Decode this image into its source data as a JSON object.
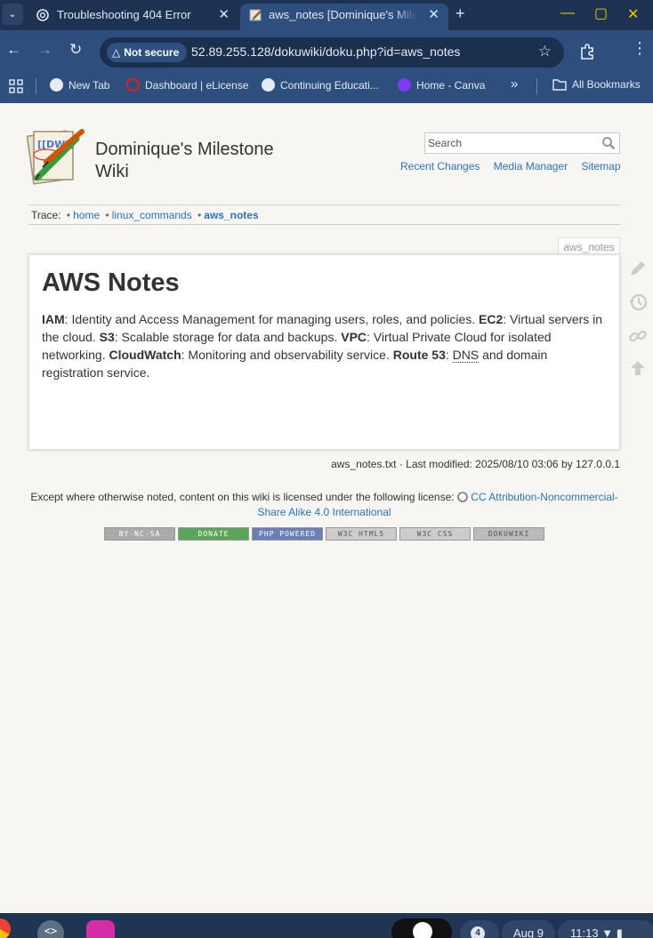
{
  "browser": {
    "tabs": [
      {
        "title": "Troubleshooting 404 Error",
        "active": false
      },
      {
        "title": "aws_notes [Dominique's Milestone Wiki]",
        "active": true
      }
    ],
    "security_label": "Not secure",
    "url": "52.89.255.128/dokuwiki/doku.php?id=aws_notes",
    "bookmarks": [
      "New Tab",
      "Dashboard | eLicense",
      "Continuing Educati...",
      "Home - Canva"
    ],
    "all_bookmarks_label": "All Bookmarks"
  },
  "wiki": {
    "site_title": "Dominique's Milestone Wiki",
    "search_placeholder": "Search",
    "tools": [
      "Recent Changes",
      "Media Manager",
      "Sitemap"
    ],
    "trace_label": "Trace:",
    "trace": [
      "home",
      "linux_commands",
      "aws_notes"
    ],
    "page_id": "aws_notes",
    "heading": "AWS Notes",
    "content": [
      {
        "term": "IAM",
        "desc": ": Identity and Access Management for managing users, roles, and policies. "
      },
      {
        "term": "EC2",
        "desc": ": Virtual servers in the cloud. "
      },
      {
        "term": "S3",
        "desc": ": Scalable storage for data and backups. "
      },
      {
        "term": "VPC",
        "desc": ": Virtual Private Cloud for isolated networking. "
      },
      {
        "term": "CloudWatch",
        "desc": ": Monitoring and observability service. "
      },
      {
        "term": "Route 53",
        "desc": ": "
      }
    ],
    "content_abbr": "DNS",
    "content_tail": " and domain registration service.",
    "docinfo": "aws_notes.txt · Last modified: 2025/08/10 03:06 by 127.0.0.1",
    "license_prefix": "Except where otherwise noted, content on this wiki is licensed under the following license:",
    "license_link": "CC Attribution-Noncommercial-Share Alike 4.0 International",
    "badges": [
      "BY-NC-SA",
      "DONATE",
      "PHP POWERED",
      "W3C HTML5",
      "W3C CSS",
      "DOKUWIKI"
    ]
  },
  "shelf": {
    "date": "Aug 9",
    "time": "11:13",
    "notification_count": "4"
  },
  "colors": {
    "chrome_dark": "#1e3354",
    "chrome": "#2e4e7e",
    "link": "#2b73b7",
    "page_bg": "#f7f6f3"
  }
}
